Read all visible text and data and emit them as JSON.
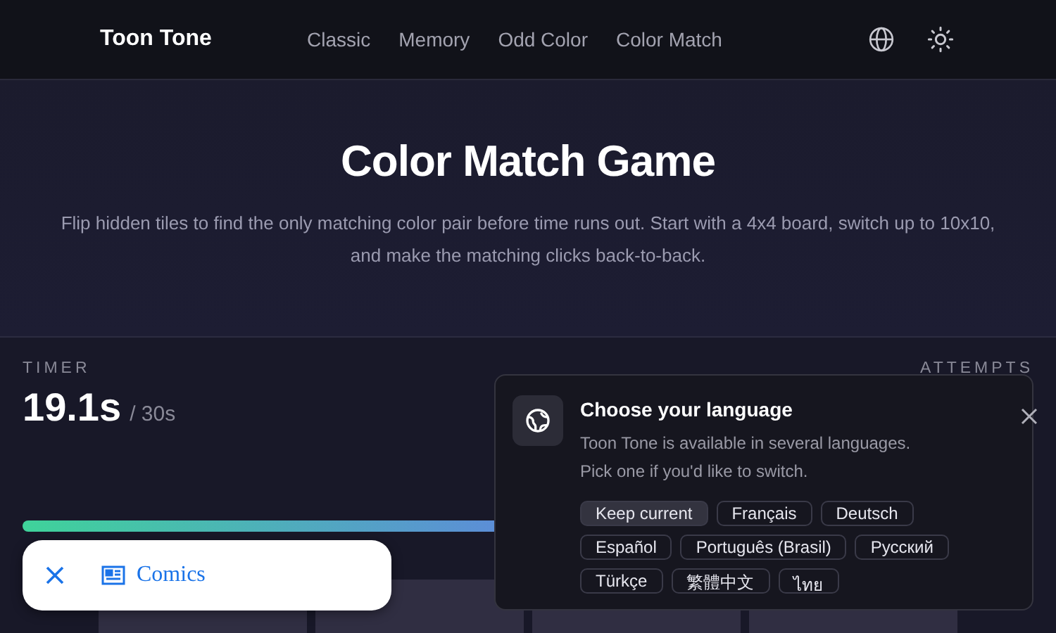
{
  "header": {
    "brand": "Toon Tone",
    "nav": [
      {
        "label": "Classic",
        "selected": false
      },
      {
        "label": "Memory",
        "selected": false
      },
      {
        "label": "Odd Color",
        "selected": false
      },
      {
        "label": "Color Match",
        "selected": false
      }
    ]
  },
  "hero": {
    "title": "Color Match Game",
    "description": "Flip hidden tiles to find the only matching color pair before time runs out. Start with a 4x4 board, switch up to 10x10, and make the matching clicks back-to-back."
  },
  "stats": {
    "timer": {
      "label": "TIMER",
      "value": "19.1s",
      "limit": "/ 30s"
    },
    "attempts": {
      "label": "ATTEMPTS"
    }
  },
  "board": {
    "tiles": [
      {
        "kind": "hidden"
      },
      {
        "kind": "hidden"
      },
      {
        "kind": "hidden"
      },
      {
        "kind": "hidden"
      }
    ]
  },
  "language_popup": {
    "title": "Choose your language",
    "message": "Toon Tone is available in several languages. Pick one if you'd like to switch.",
    "options": [
      {
        "label": "Keep current",
        "selected": true
      },
      {
        "label": "Français",
        "selected": false
      },
      {
        "label": "Deutsch",
        "selected": false
      },
      {
        "label": "Español",
        "selected": false
      },
      {
        "label": "Português (Brasil)",
        "selected": false
      },
      {
        "label": "Русский",
        "selected": false
      },
      {
        "label": "Türkçe",
        "selected": false
      },
      {
        "label": "繁體中文",
        "selected": false
      },
      {
        "label": "ไทย",
        "selected": false
      }
    ]
  },
  "toast": {
    "label": "Comics"
  }
}
